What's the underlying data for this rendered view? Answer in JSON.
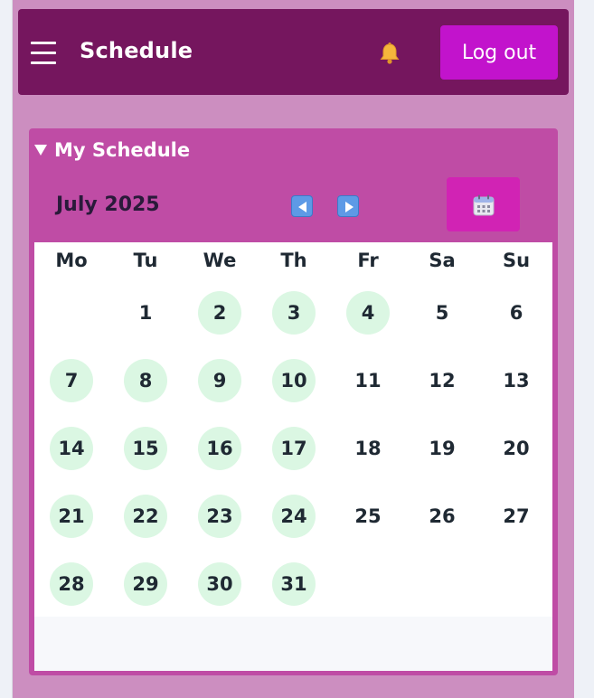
{
  "header": {
    "title": "Schedule",
    "logout_label": "Log out",
    "bell_icon": "bell-icon",
    "menu_icon": "hamburger-menu-icon"
  },
  "schedule_panel": {
    "title": "My Schedule",
    "month_label": "July 2025",
    "prev_icon": "arrow-left-icon",
    "next_icon": "arrow-right-icon",
    "calendar_icon": "calendar-icon"
  },
  "calendar": {
    "weekdays": [
      "Mo",
      "Tu",
      "We",
      "Th",
      "Fr",
      "Sa",
      "Su"
    ],
    "first_weekday_index": 1,
    "days_in_month": 31,
    "scheduled_days": [
      2,
      3,
      4,
      7,
      8,
      9,
      10,
      14,
      15,
      16,
      17,
      21,
      22,
      23,
      24,
      28,
      29,
      30,
      31
    ]
  },
  "colors": {
    "header_bg": "#75165e",
    "logout_bg": "#c213cc",
    "panel_bg": "#bf4ca5",
    "scheduled_day_bg": "#dbf7e3"
  }
}
